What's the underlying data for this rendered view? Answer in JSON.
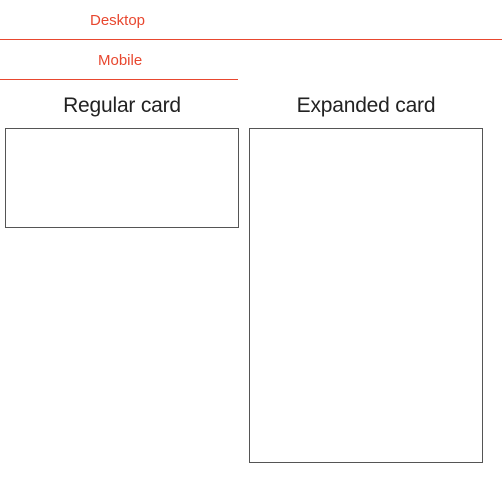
{
  "tabs": {
    "desktop": "Desktop",
    "mobile": "Mobile"
  },
  "cards": {
    "regular": {
      "title": "Regular card"
    },
    "expanded": {
      "title": "Expanded card"
    }
  }
}
